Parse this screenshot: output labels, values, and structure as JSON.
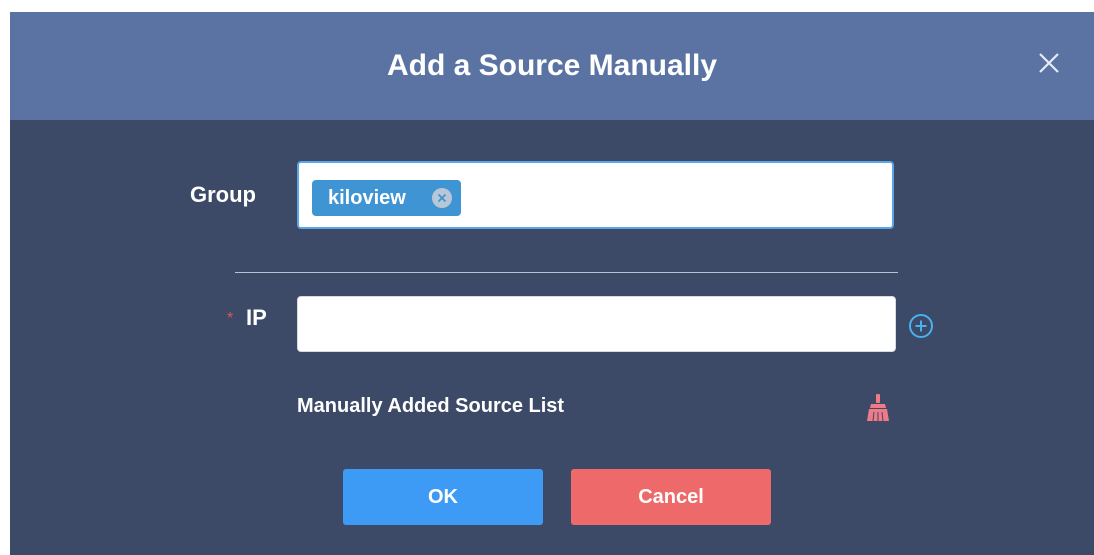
{
  "dialog": {
    "title": "Add a Source Manually",
    "close_icon": "close-icon"
  },
  "form": {
    "group_label": "Group",
    "group_tags": [
      {
        "label": "kiloview",
        "remove_icon": "tag-remove-icon"
      }
    ],
    "ip_required_mark": "*",
    "ip_label": "IP",
    "ip_value": "",
    "add_ip_icon": "plus-circle-icon",
    "list_title": "Manually Added Source List",
    "clear_list_icon": "broom-icon"
  },
  "buttons": {
    "ok_label": "OK",
    "cancel_label": "Cancel"
  },
  "colors": {
    "header_bg": "#5a73a3",
    "body_bg": "#3c4a68",
    "accent": "#3d9bf5",
    "tag_bg": "#3f94d4",
    "danger": "#ee6a6a",
    "required": "#e05555"
  }
}
